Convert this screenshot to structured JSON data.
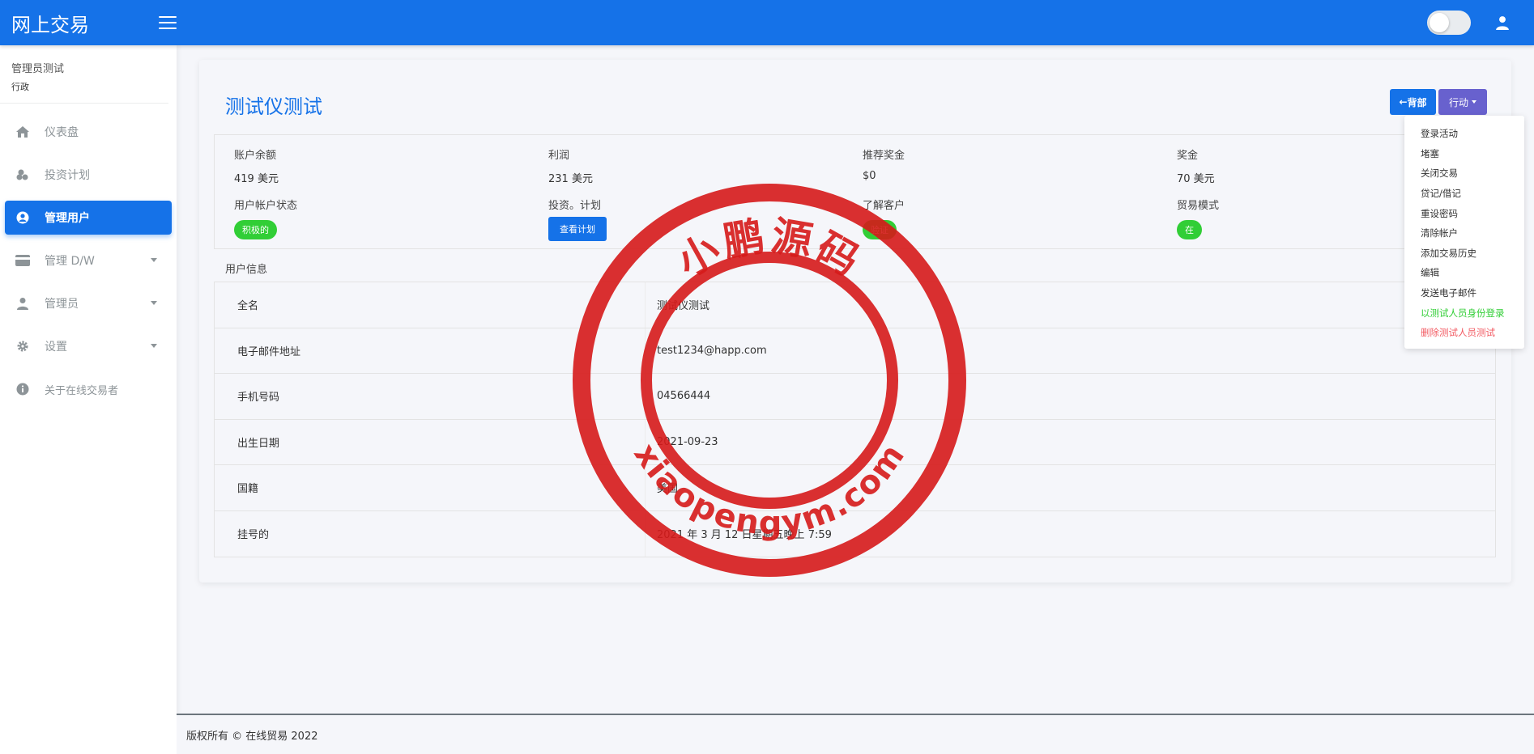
{
  "brand": "网上交易",
  "sidebar": {
    "profile_name": "管理员测试",
    "profile_role": "行政",
    "items": [
      {
        "label": "仪表盘"
      },
      {
        "label": "投资计划"
      },
      {
        "label": "管理用户"
      },
      {
        "label": "管理 D/W"
      },
      {
        "label": "管理员"
      },
      {
        "label": "设置"
      },
      {
        "label": "关于在线交易者"
      }
    ]
  },
  "page": {
    "title": "测试仪测试",
    "back_label": "背部",
    "action_label": "行动"
  },
  "summary": {
    "balance_label": "账户余额",
    "balance_value": "419 美元",
    "profit_label": "利润",
    "profit_value": "231 美元",
    "referral_label": "推荐奖金",
    "referral_value": "$0",
    "bonus_label": "奖金",
    "bonus_value": "70 美元",
    "status_label": "用户帐户状态",
    "status_value": "积极的",
    "plan_label": "投资。计划",
    "plan_button": "查看计划",
    "kyc_label": "了解客户",
    "kyc_value": "验证",
    "trade_label": "贸易模式",
    "trade_value": "在"
  },
  "user_info": {
    "section_label": "用户信息",
    "rows": [
      {
        "key": "全名",
        "value": "测试仪测试"
      },
      {
        "key": "电子邮件地址",
        "value": "test1234@happ.com"
      },
      {
        "key": "手机号码",
        "value": "04566444"
      },
      {
        "key": "出生日期",
        "value": "2021-09-23"
      },
      {
        "key": "国籍",
        "value": "美国"
      },
      {
        "key": "挂号的",
        "value": "2021 年 3 月 12 日星期五晚上 7:59"
      }
    ]
  },
  "dropdown": {
    "items": [
      "登录活动",
      "堵塞",
      "关闭交易",
      "贷记/借记",
      "重设密码",
      "清除帐户",
      "添加交易历史",
      "编辑",
      "发送电子邮件",
      "以测试人员身份登录",
      "删除测试人员测试"
    ]
  },
  "footer": "版权所有 © 在线贸易 2022",
  "watermark": {
    "top_text": "小鹏源码",
    "bottom_text": "xiaopengym.com"
  },
  "colors": {
    "primary": "#1572e8",
    "secondary": "#6861ce",
    "success": "#31ce36",
    "danger": "#f25961",
    "stamp": "#d61a1a"
  }
}
